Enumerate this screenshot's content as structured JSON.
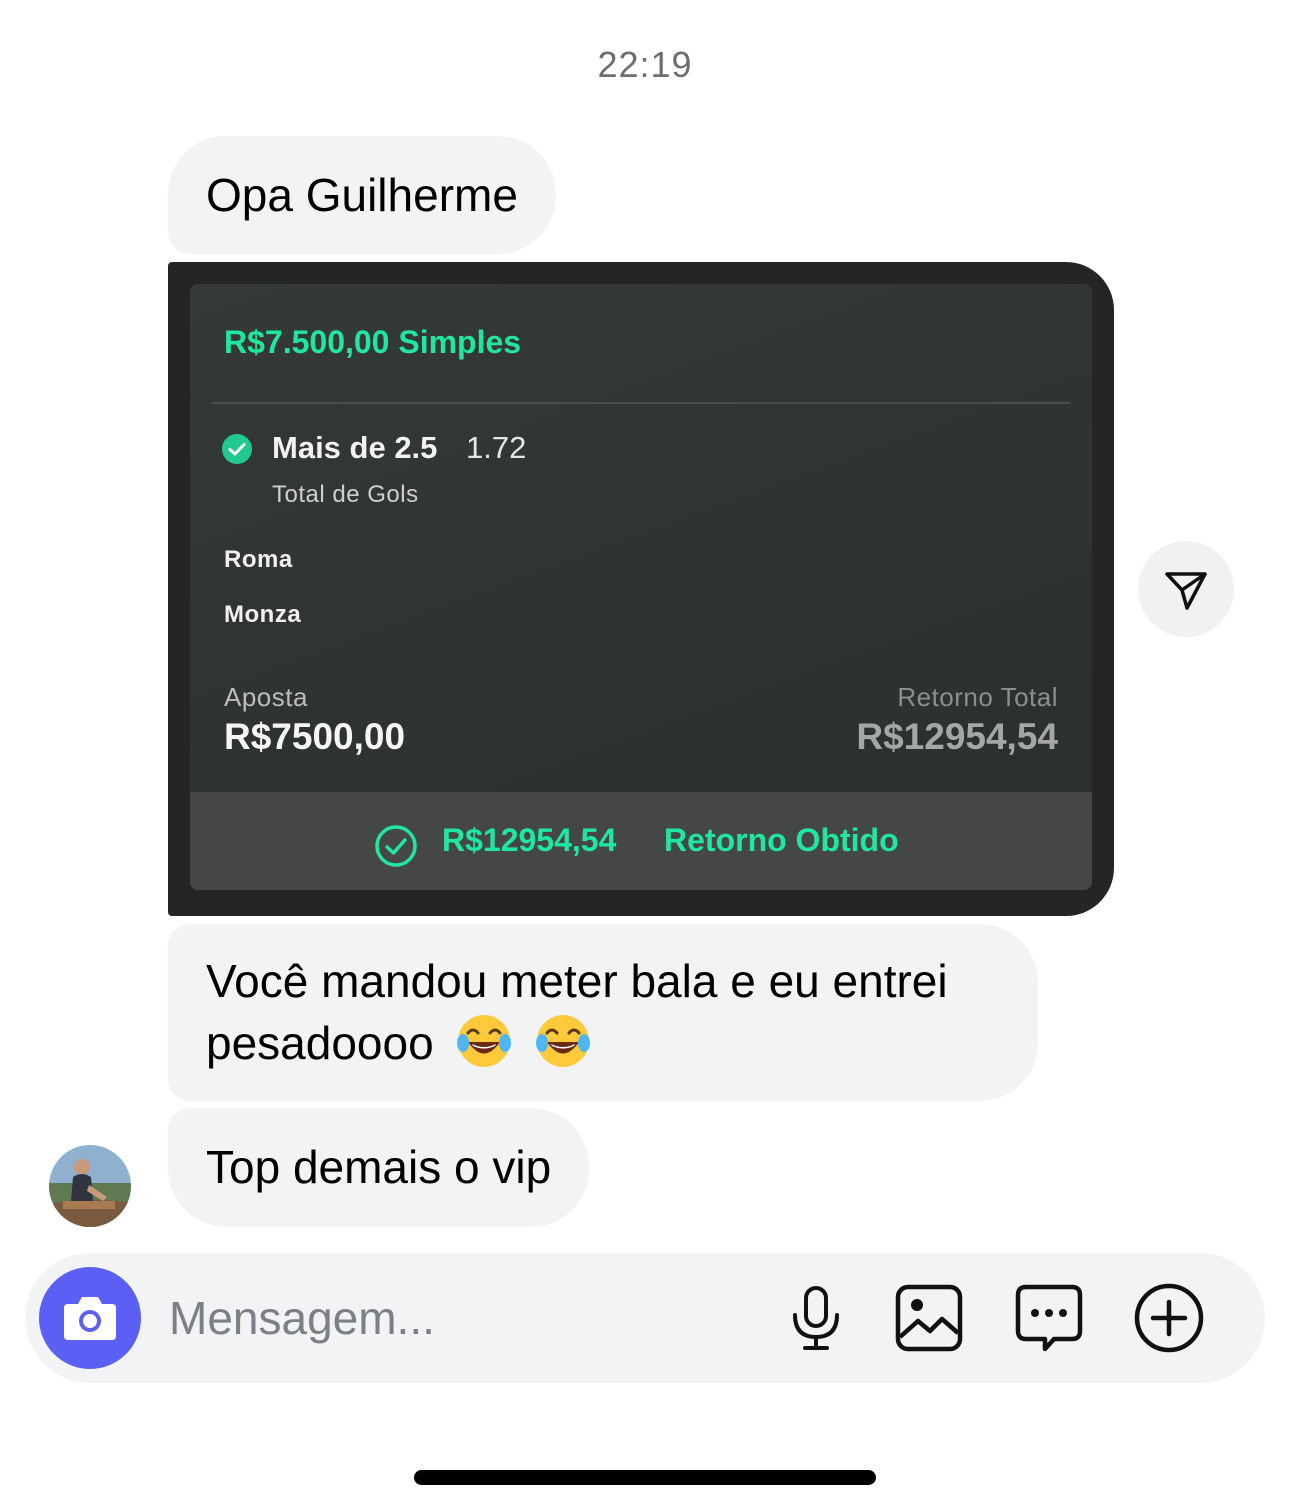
{
  "header": {
    "time": "22:19"
  },
  "messages": [
    {
      "text": "Opa Guilherme"
    },
    {
      "bet_card": {
        "title": "R$7.500,00 Simples",
        "market": "Mais de 2.5",
        "odds": "1.72",
        "market_type": "Total de Gols",
        "team_home": "Roma",
        "team_away": "Monza",
        "stake_label": "Aposta",
        "stake_value": "R$7500,00",
        "return_label": "Retorno Total",
        "return_value": "R$12954,54",
        "result_amount": "R$12954,54",
        "result_text": "Retorno Obtido",
        "accent_color": "#1fe7a0"
      }
    },
    {
      "text": "Você mandou meter bala e eu entrei pesadoooo",
      "emojis": [
        "face-with-tears-of-joy",
        "face-with-tears-of-joy"
      ]
    },
    {
      "text": "Top demais o vip"
    }
  ],
  "composer": {
    "placeholder": "Mensagem...",
    "camera_color": "#5b5ff3",
    "icons": [
      "camera-icon",
      "microphone-icon",
      "gallery-icon",
      "sticker-icon",
      "plus-icon"
    ]
  }
}
